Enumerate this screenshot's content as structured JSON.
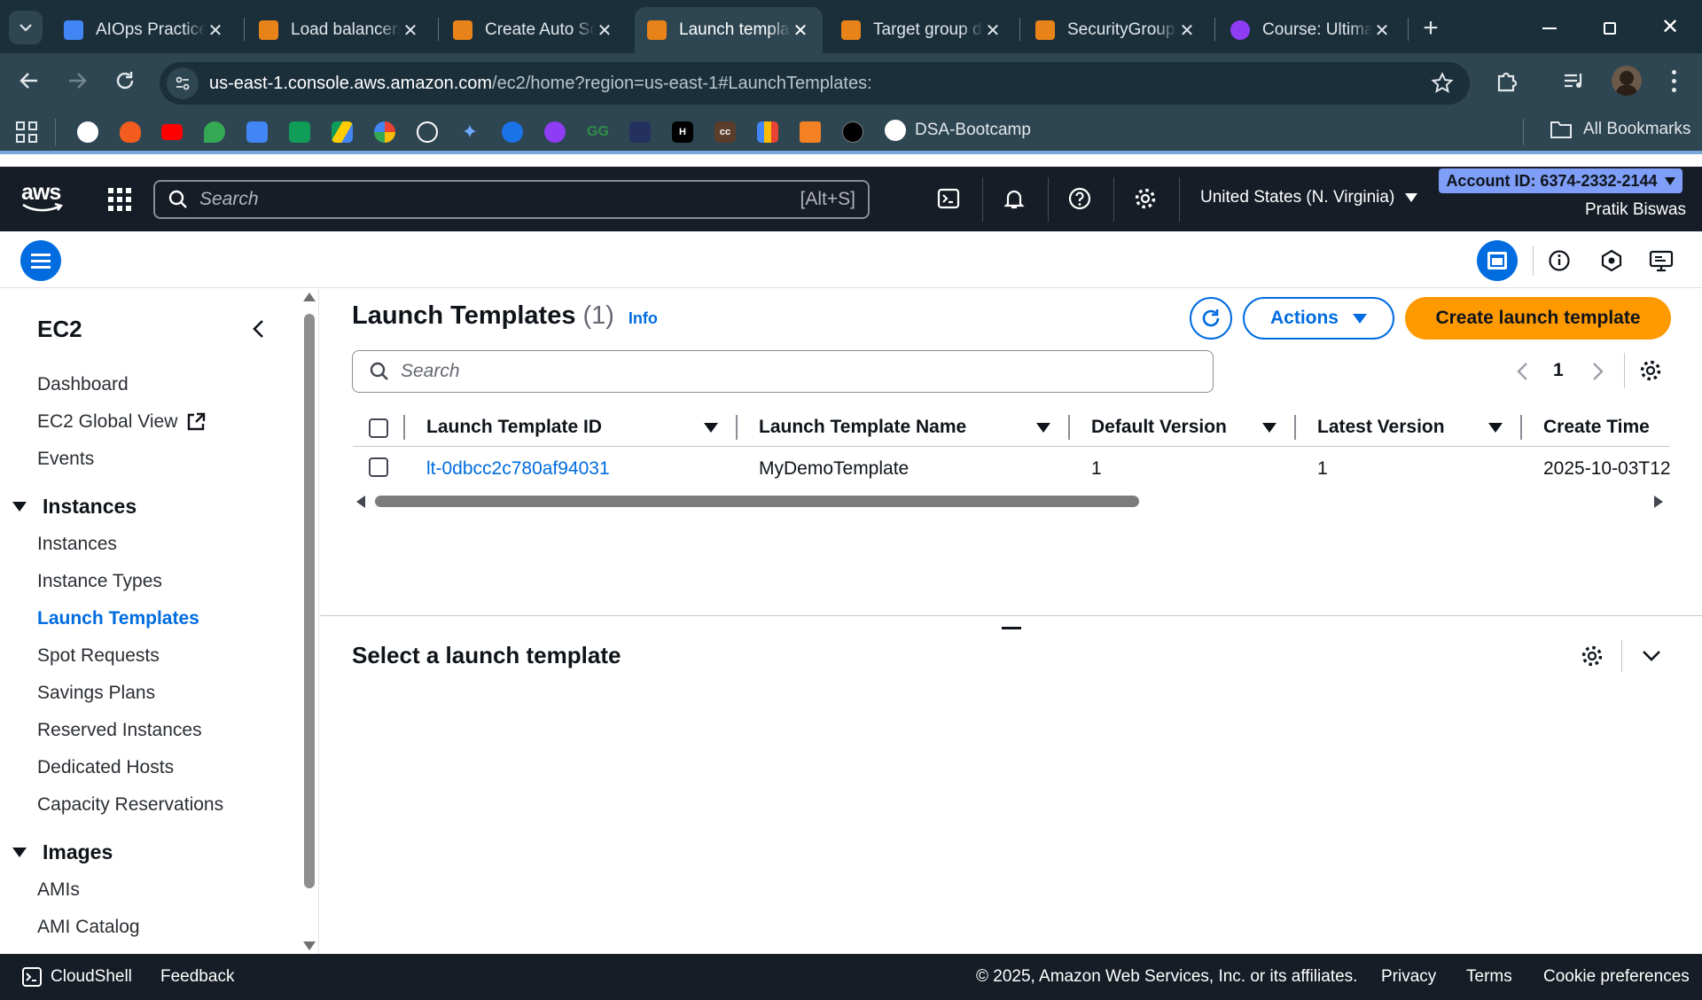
{
  "browser": {
    "tabs": [
      {
        "title": "AIOps Practice",
        "favicon_color": "#4285f4",
        "active": false
      },
      {
        "title": "Load balancers",
        "favicon_color": "#e8831a",
        "active": false
      },
      {
        "title": "Create Auto Scaling",
        "favicon_color": "#e8831a",
        "active": false
      },
      {
        "title": "Launch templates",
        "favicon_color": "#e8831a",
        "active": true
      },
      {
        "title": "Target group details",
        "favicon_color": "#e8831a",
        "active": false
      },
      {
        "title": "SecurityGroups",
        "favicon_color": "#e8831a",
        "active": false
      },
      {
        "title": "Course: Ultimate",
        "favicon_color": "#8f3cf5",
        "active": false
      }
    ],
    "url_host": "us-east-1.console.aws.amazon.com",
    "url_path": "/ec2/home?region=us-east-1#LaunchTemplates:",
    "bookmarks": {
      "items": [
        "apps-grid-icon",
        "p-icon",
        "flame-icon",
        "youtube-icon",
        "maps-icon",
        "docs-icon",
        "sheets-icon",
        "drive-icon",
        "photos-icon",
        "chatgpt-icon",
        "gemini-icon",
        "c-icon",
        "u-icon",
        "gfg-icon",
        "dark-square-icon",
        "hackerrank-icon",
        "cc-icon",
        "chart-icon",
        "stack-icon",
        "tuf-icon",
        "github-icon"
      ],
      "github_label": "DSA-Bootcamp",
      "all_bookmarks_label": "All Bookmarks"
    }
  },
  "aws_header": {
    "search_placeholder": "Search",
    "search_shortcut": "[Alt+S]",
    "region": "United States (N. Virginia)",
    "account_id": "Account ID: 6374-2332-2144",
    "user": "Pratik Biswas"
  },
  "sidebar": {
    "title": "EC2",
    "items_top": [
      "Dashboard",
      "EC2 Global View",
      "Events"
    ],
    "instances_section": "Instances",
    "instances_items": [
      "Instances",
      "Instance Types",
      "Launch Templates",
      "Spot Requests",
      "Savings Plans",
      "Reserved Instances",
      "Dedicated Hosts",
      "Capacity Reservations"
    ],
    "active_item": "Launch Templates",
    "images_section": "Images",
    "images_items": [
      "AMIs",
      "AMI Catalog"
    ]
  },
  "main": {
    "title": "Launch Templates",
    "count": "(1)",
    "info_link": "Info",
    "actions_label": "Actions",
    "create_label": "Create launch template",
    "search_placeholder": "Search",
    "page_number": "1",
    "columns": [
      "Launch Template ID",
      "Launch Template Name",
      "Default Version",
      "Latest Version",
      "Create Time"
    ],
    "rows": [
      {
        "id": "lt-0dbcc2c780af94031",
        "name": "MyDemoTemplate",
        "default_version": "1",
        "latest_version": "1",
        "create_time": "2025-10-03T12"
      }
    ],
    "detail_title": "Select a launch template"
  },
  "footer": {
    "cloudshell": "CloudShell",
    "feedback": "Feedback",
    "copyright": "© 2025, Amazon Web Services, Inc. or its affiliates.",
    "privacy": "Privacy",
    "terms": "Terms",
    "cookies": "Cookie preferences"
  },
  "colors": {
    "aws_orange": "#ff9900",
    "link_blue": "#006ce0",
    "header_dark": "#161d26"
  }
}
